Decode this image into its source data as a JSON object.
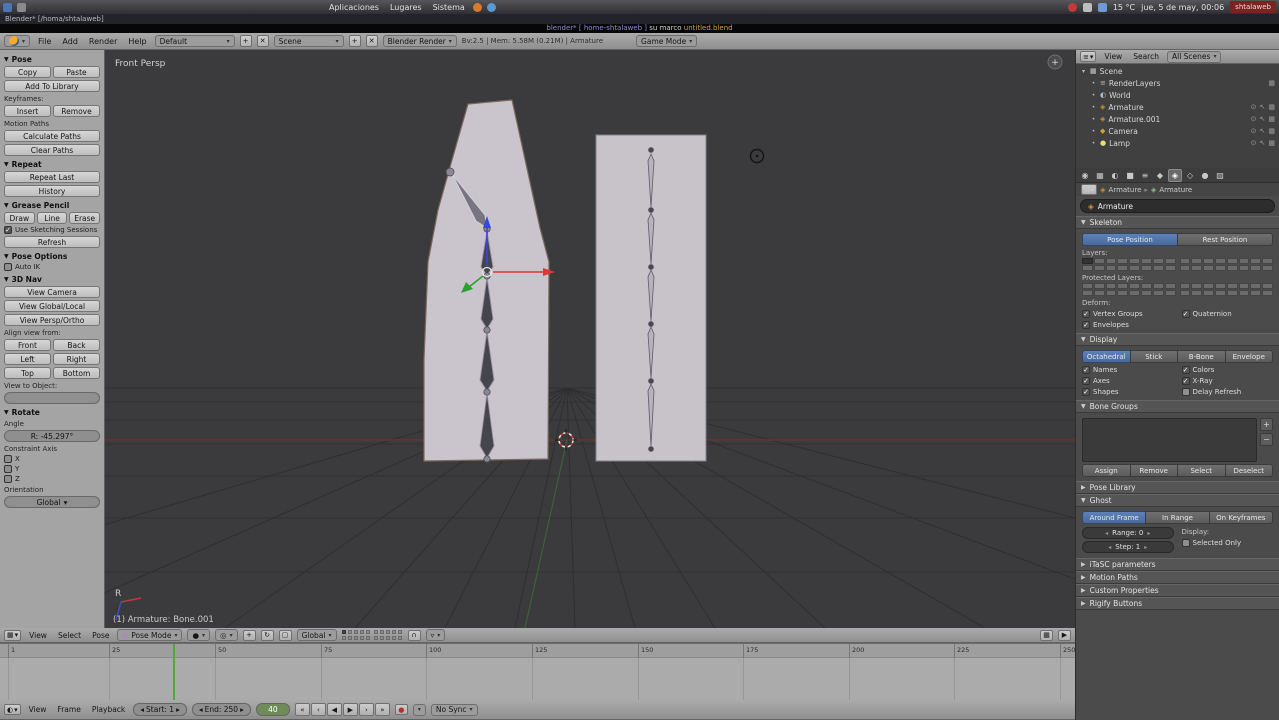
{
  "colors": {
    "selected_blue": "#49699c",
    "playhead_green": "#55a643",
    "mesh_gray": "#cac5cc",
    "armature_orange": "#d98f2e",
    "watermark_red": "#7a2420",
    "viewport_bg": "#3b3b3e"
  },
  "taskbar": {
    "menus": [
      "Aplicaciones",
      "Lugares",
      "Sistema"
    ],
    "temperature": "15 °C",
    "clock": "jue, 5 de may, 00:06",
    "watermark": "shtalaweb"
  },
  "window": {
    "title": "Blender* [/homa/shtalaweb]",
    "video_title_a": "blender* [ home-shtalaweb ]",
    "video_title_b": " su marco ",
    "video_title_c": "untitled.blend"
  },
  "info_header": {
    "menus": [
      "File",
      "Add",
      "Render",
      "Help"
    ],
    "layout_name": "Default",
    "scene_name": "Scene",
    "engine": "Blender Render",
    "stats": "Bv:2.5 | Mem: 5.58M (0.21M) | Armature",
    "game_mode": "Game Mode"
  },
  "tool_shelf": {
    "panels": [
      {
        "type": "header",
        "label": "Pose"
      },
      {
        "type": "row",
        "buttons": [
          "Copy",
          "Paste"
        ]
      },
      {
        "type": "button",
        "label": "Add To Library"
      },
      {
        "type": "label",
        "label": "Keyframes:"
      },
      {
        "type": "row",
        "buttons": [
          "Insert",
          "Remove"
        ]
      },
      {
        "type": "label",
        "label": "Motion Paths"
      },
      {
        "type": "button",
        "label": "Calculate Paths"
      },
      {
        "type": "button",
        "label": "Clear Paths"
      },
      {
        "type": "header",
        "label": "Repeat"
      },
      {
        "type": "button",
        "label": "Repeat Last"
      },
      {
        "type": "button",
        "label": "History"
      },
      {
        "type": "header",
        "label": "Grease Pencil"
      },
      {
        "type": "row",
        "buttons": [
          "Draw",
          "Line",
          "Erase"
        ]
      },
      {
        "type": "check",
        "label": "Use Sketching Sessions",
        "checked": true
      },
      {
        "type": "button",
        "label": "Refresh"
      },
      {
        "type": "header",
        "label": "Pose Options"
      },
      {
        "type": "check",
        "label": "Auto IK",
        "checked": false
      },
      {
        "type": "header",
        "label": "3D Nav"
      },
      {
        "type": "button",
        "label": "View Camera"
      },
      {
        "type": "button",
        "label": "View Global/Local"
      },
      {
        "type": "button",
        "label": "View Persp/Ortho"
      },
      {
        "type": "label",
        "label": "Align view from:"
      },
      {
        "type": "row",
        "buttons": [
          "Front",
          "Back"
        ]
      },
      {
        "type": "row",
        "buttons": [
          "Left",
          "Right"
        ]
      },
      {
        "type": "row",
        "buttons": [
          "Top",
          "Bottom"
        ]
      },
      {
        "type": "label",
        "label": "View to Object:"
      },
      {
        "type": "field",
        "label": ""
      },
      {
        "type": "header",
        "label": "Rotate"
      },
      {
        "type": "label",
        "label": "Angle"
      },
      {
        "type": "field",
        "label": "R: -45.297°"
      },
      {
        "type": "label",
        "label": "Constraint Axis"
      },
      {
        "type": "check",
        "label": "X",
        "checked": false
      },
      {
        "type": "check",
        "label": "Y",
        "checked": false
      },
      {
        "type": "check",
        "label": "Z",
        "checked": false
      },
      {
        "type": "label",
        "label": "Orientation"
      },
      {
        "type": "select",
        "label": "Global"
      }
    ]
  },
  "viewport": {
    "view_label": "Front Persp",
    "rotate_indicator": "R",
    "active_bone_label": "(1) Armature: Bone.001"
  },
  "viewport_header": {
    "menus": [
      "View",
      "Select",
      "Pose"
    ],
    "mode": "Pose Mode",
    "orientation": "Global"
  },
  "outliner": {
    "view_menu": "View",
    "search_menu": "Search",
    "display_filter": "All Scenes",
    "items": [
      {
        "label": "Scene",
        "icon": "scene",
        "depth": 0,
        "expanded": true,
        "right": []
      },
      {
        "label": "RenderLayers",
        "icon": "renderlayer",
        "depth": 1,
        "right": [
          "render"
        ]
      },
      {
        "label": "World",
        "icon": "world",
        "depth": 1,
        "right": []
      },
      {
        "label": "Armature",
        "icon": "armature",
        "depth": 1,
        "right": [
          "eye",
          "select",
          "render"
        ]
      },
      {
        "label": "Armature.001",
        "icon": "armature",
        "depth": 1,
        "right": [
          "eye",
          "select",
          "render"
        ]
      },
      {
        "label": "Camera",
        "icon": "camera",
        "depth": 1,
        "right": [
          "eye",
          "select",
          "render"
        ]
      },
      {
        "label": "Lamp",
        "icon": "lamp",
        "depth": 1,
        "right": [
          "eye",
          "select",
          "render"
        ]
      }
    ]
  },
  "properties": {
    "tabs": [
      "render",
      "scene",
      "world",
      "object",
      "constraints",
      "modifiers",
      "object-data",
      "bone",
      "material",
      "texture"
    ],
    "active_tab": "object-data",
    "breadcrumb": {
      "object": "Armature",
      "data": "Armature"
    },
    "name_field": "Armature",
    "skeleton": {
      "title": "Skeleton",
      "position_modes": [
        "Pose Position",
        "Rest Position"
      ],
      "active_position": "Pose Position",
      "layers_label": "Layers:",
      "protected_layers_label": "Protected Layers:",
      "deform_label": "Deform:",
      "checks_left": [
        {
          "label": "Vertex Groups",
          "checked": true
        },
        {
          "label": "Envelopes",
          "checked": true
        }
      ],
      "checks_right": [
        {
          "label": "Quaternion",
          "checked": true
        }
      ]
    },
    "display": {
      "title": "Display",
      "style_modes": [
        "Octahedral",
        "Stick",
        "B-Bone",
        "Envelope"
      ],
      "active_style": "Octahedral",
      "checks_left": [
        {
          "label": "Names",
          "checked": true
        },
        {
          "label": "Axes",
          "checked": true
        },
        {
          "label": "Shapes",
          "checked": true
        }
      ],
      "checks_right": [
        {
          "label": "Colors",
          "checked": true
        },
        {
          "label": "X-Ray",
          "checked": true
        },
        {
          "label": "Delay Refresh",
          "checked": false
        }
      ]
    },
    "bone_groups": {
      "title": "Bone Groups",
      "buttons": [
        "Assign",
        "Remove",
        "Select",
        "Deselect"
      ]
    },
    "pose_library_title": "Pose Library",
    "ghost": {
      "title": "Ghost",
      "modes": [
        "Around Frame",
        "In Range",
        "On Keyframes"
      ],
      "active_mode": "Around Frame",
      "range": "Range: 0",
      "step": "Step: 1",
      "display_label": "Display:",
      "selected_only": "Selected Only"
    },
    "collapsed_panels": [
      "iTaSC parameters",
      "Motion Paths",
      "Custom Properties",
      "Rigify Buttons"
    ]
  },
  "timeline": {
    "menus": [
      "View",
      "Frame",
      "Playback"
    ],
    "start": "Start: 1",
    "end": "End: 250",
    "current_frame": "40",
    "ticks": [
      1,
      25,
      50,
      75,
      100,
      125,
      150,
      175,
      200,
      225,
      250
    ],
    "playhead_frame": 40,
    "sync_mode": "No Sync",
    "transport": [
      "jump-to-start",
      "previous-keyframe",
      "play-reverse",
      "play",
      "next-keyframe",
      "jump-to-end"
    ]
  }
}
